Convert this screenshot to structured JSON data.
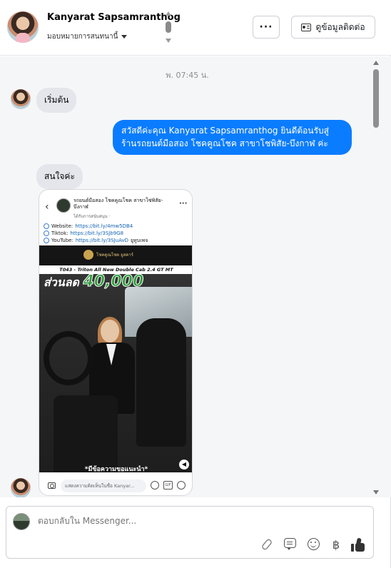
{
  "header": {
    "contact_name": "Kanyarat Sapsamranthog",
    "assign_label": "มอบหมายการสนทนานี้",
    "more_label": "···",
    "contact_info_label": "ดูข้อมูลติดต่อ"
  },
  "conversation": {
    "timestamp": "พ. 07:45 น.",
    "messages": [
      {
        "direction": "incoming",
        "text": "เริ่มต้น"
      },
      {
        "direction": "outgoing",
        "text": "สวัสดีค่ะคุณ Kanyarat Sapsamranthog ยินดีต้อนรับสู่ร้านรถยนต์มือสอง โชคคูณโชค สาขาโชพิสัย-บึงกาฬ ค่ะ"
      },
      {
        "direction": "incoming",
        "text": "สนใจค่ะ"
      }
    ],
    "shared_post": {
      "page_name": "รถยนต์มือสอง โชคคูณโชค สาขาโซ่พิสัย-บึงกาฬ",
      "page_sub": "ได้รับการสนับสนุน ·",
      "links": [
        {
          "label": "Website:",
          "url": "https://bit.ly/4mw5DB4"
        },
        {
          "label": "Tiktok:",
          "url": "https://bit.ly/3SJb9G8"
        },
        {
          "label": "YouTube:",
          "url": "https://bit.ly/3SJuAvD",
          "suffix": "ยูทูบเพจ"
        }
      ],
      "image": {
        "brand": "โชคคูณโชค ยูสคาร์",
        "model": "T043 - Triton All New Double Cab 2.4 GT MT",
        "promo_prefix": "ส่วนลด",
        "promo_amount": "40,000",
        "caption": "*มีข้อความขอแนะนำ*"
      },
      "comment_placeholder": "แสดงความคิดเห็นในชื่อ Kanyar..."
    }
  },
  "composer": {
    "placeholder": "ตอบกลับใน Messenger..."
  },
  "colors": {
    "outgoing_bubble": "#0a7cff",
    "incoming_bubble": "#e4e6eb",
    "background": "#f5f6f7"
  }
}
